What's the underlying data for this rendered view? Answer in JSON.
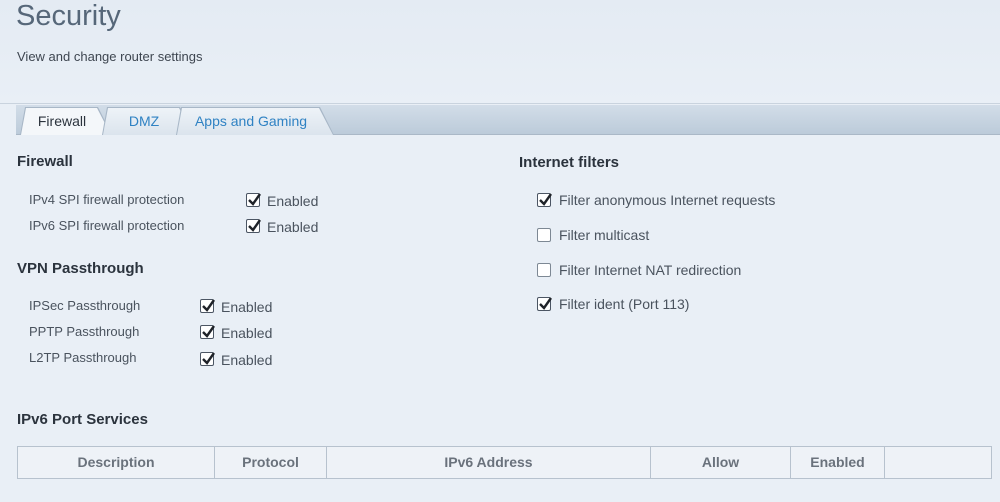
{
  "header": {
    "title": "Security",
    "subtitle": "View and change router settings"
  },
  "tabs": [
    {
      "label": "Firewall",
      "active": true
    },
    {
      "label": "DMZ",
      "active": false
    },
    {
      "label": "Apps and Gaming",
      "active": false
    }
  ],
  "firewall": {
    "title": "Firewall",
    "rows": [
      {
        "label": "IPv4 SPI firewall protection",
        "checked": true,
        "text": "Enabled"
      },
      {
        "label": "IPv6 SPI firewall protection",
        "checked": true,
        "text": "Enabled"
      }
    ]
  },
  "vpn": {
    "title": "VPN Passthrough",
    "rows": [
      {
        "label": "IPSec Passthrough",
        "checked": true,
        "text": "Enabled"
      },
      {
        "label": "PPTP Passthrough",
        "checked": true,
        "text": "Enabled"
      },
      {
        "label": "L2TP Passthrough",
        "checked": true,
        "text": "Enabled"
      }
    ]
  },
  "internet_filters": {
    "title": "Internet filters",
    "items": [
      {
        "label": "Filter anonymous Internet requests",
        "checked": true
      },
      {
        "label": "Filter multicast",
        "checked": false
      },
      {
        "label": "Filter Internet NAT redirection",
        "checked": false
      },
      {
        "label": "Filter ident (Port 113)",
        "checked": true
      }
    ]
  },
  "ipv6_ports": {
    "title": "IPv6 Port Services",
    "columns": [
      "Description",
      "Protocol",
      "IPv6 Address",
      "Allow",
      "Enabled",
      ""
    ]
  }
}
